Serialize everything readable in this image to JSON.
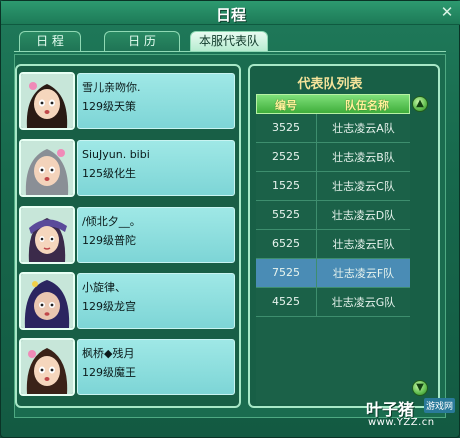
{
  "window": {
    "title": "日程",
    "close_symbol": "✕"
  },
  "tabs": [
    {
      "label": "日 程",
      "active": false
    },
    {
      "label": "日 历",
      "active": false
    },
    {
      "label": "本服代表队",
      "active": true
    }
  ],
  "members": [
    {
      "name": "雪儿亲吻你.",
      "level": "129级天策"
    },
    {
      "name": "SiuJyun. bibi",
      "level": "125级化生"
    },
    {
      "name": "/倾北夕__。",
      "level": "129级普陀"
    },
    {
      "name": "小旋律、",
      "level": "129级龙宫"
    },
    {
      "name": "枫桥◆残月",
      "level": "129级魔王"
    }
  ],
  "team_list": {
    "title": "代表队列表",
    "header": {
      "id": "编号",
      "name": "队伍名称"
    },
    "rows": [
      {
        "id": "3525",
        "name": "壮志凌云A队",
        "selected": false
      },
      {
        "id": "2525",
        "name": "壮志凌云B队",
        "selected": false
      },
      {
        "id": "1525",
        "name": "壮志凌云C队",
        "selected": false
      },
      {
        "id": "5525",
        "name": "壮志凌云D队",
        "selected": false
      },
      {
        "id": "6525",
        "name": "壮志凌云E队",
        "selected": false
      },
      {
        "id": "7525",
        "name": "壮志凌云F队",
        "selected": true
      },
      {
        "id": "4525",
        "name": "壮志凌云G队",
        "selected": false
      }
    ],
    "scroll_up_icon": "chevron-up",
    "scroll_down_icon": "chevron-down"
  },
  "watermark": {
    "logo": "叶子猪",
    "badge": "游戏网",
    "url": "www.YZZ.cn"
  },
  "colors": {
    "background": "#17684c",
    "selected_row": "#4a8cb5",
    "panel_title": "#f4e39a",
    "member_card": "#9fe8e6"
  }
}
